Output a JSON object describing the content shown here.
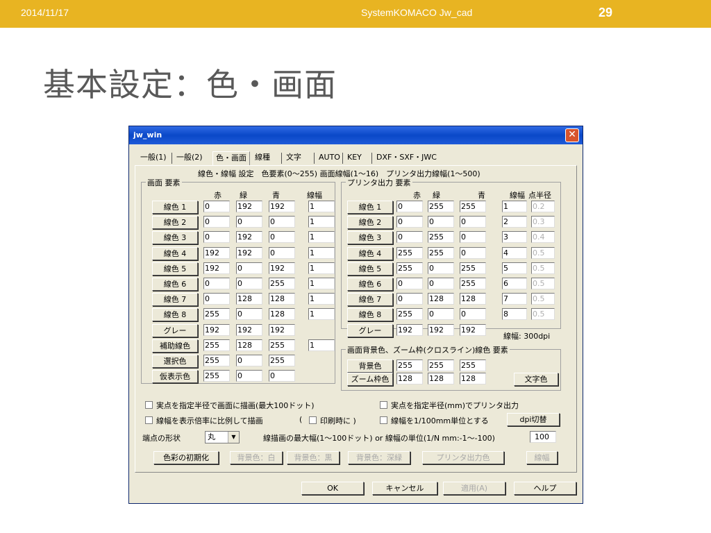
{
  "slide": {
    "date": "2014/11/17",
    "center": "SystemKOMACO Jw_cad",
    "page_number": "29",
    "title": "基本設定：色・画面"
  },
  "window": {
    "title": "jw_win",
    "close_glyph": "✕"
  },
  "tabs": [
    "一般(1)",
    "一般(2)",
    "色・画面",
    "線種",
    "文字",
    "AUTO",
    "KEY",
    "DXF・SXF・JWC"
  ],
  "header_text": "線色・線幅 設定　色要素(0〜255)  画面線幅(1〜16)　プリンタ出力線幅(1〜500)",
  "screen_group": {
    "title": "画面 要素",
    "col_headers": [
      "赤",
      "緑",
      "青",
      "線幅"
    ],
    "rows": [
      {
        "label": "線色 1",
        "r": "0",
        "g": "192",
        "b": "192",
        "w": "1"
      },
      {
        "label": "線色 2",
        "r": "0",
        "g": "0",
        "b": "0",
        "w": "1"
      },
      {
        "label": "線色 3",
        "r": "0",
        "g": "192",
        "b": "0",
        "w": "1"
      },
      {
        "label": "線色 4",
        "r": "192",
        "g": "192",
        "b": "0",
        "w": "1"
      },
      {
        "label": "線色 5",
        "r": "192",
        "g": "0",
        "b": "192",
        "w": "1"
      },
      {
        "label": "線色 6",
        "r": "0",
        "g": "0",
        "b": "255",
        "w": "1"
      },
      {
        "label": "線色 7",
        "r": "0",
        "g": "128",
        "b": "128",
        "w": "1"
      },
      {
        "label": "線色 8",
        "r": "255",
        "g": "0",
        "b": "128",
        "w": "1"
      },
      {
        "label": "グレー",
        "r": "192",
        "g": "192",
        "b": "192",
        "w": ""
      },
      {
        "label": "補助線色",
        "r": "255",
        "g": "128",
        "b": "255",
        "w": "1"
      },
      {
        "label": "選択色",
        "r": "255",
        "g": "0",
        "b": "255",
        "w": ""
      },
      {
        "label": "仮表示色",
        "r": "255",
        "g": "0",
        "b": "0",
        "w": ""
      }
    ]
  },
  "printer_group": {
    "title": "プリンタ出力 要素",
    "col_headers": [
      "赤",
      "緑",
      "青",
      "線幅",
      "点半径"
    ],
    "rows": [
      {
        "label": "線色 1",
        "r": "0",
        "g": "255",
        "b": "255",
        "w": "1",
        "p": "0.2"
      },
      {
        "label": "線色 2",
        "r": "0",
        "g": "0",
        "b": "0",
        "w": "2",
        "p": "0.3"
      },
      {
        "label": "線色 3",
        "r": "0",
        "g": "255",
        "b": "0",
        "w": "3",
        "p": "0.4"
      },
      {
        "label": "線色 4",
        "r": "255",
        "g": "255",
        "b": "0",
        "w": "4",
        "p": "0.5"
      },
      {
        "label": "線色 5",
        "r": "255",
        "g": "0",
        "b": "255",
        "w": "5",
        "p": "0.5"
      },
      {
        "label": "線色 6",
        "r": "0",
        "g": "0",
        "b": "255",
        "w": "6",
        "p": "0.5"
      },
      {
        "label": "線色 7",
        "r": "0",
        "g": "128",
        "b": "128",
        "w": "7",
        "p": "0.5"
      },
      {
        "label": "線色 8",
        "r": "255",
        "g": "0",
        "b": "0",
        "w": "8",
        "p": "0.5"
      },
      {
        "label": "グレー",
        "r": "192",
        "g": "192",
        "b": "192",
        "w": "",
        "p": ""
      }
    ],
    "dpi_text": "線幅: 300dpi"
  },
  "bg_group": {
    "title": "画面背景色、ズーム枠(クロスライン)線色 要素",
    "rows": [
      {
        "label": "背景色",
        "r": "255",
        "g": "255",
        "b": "255"
      },
      {
        "label": "ズーム枠色",
        "r": "128",
        "g": "128",
        "b": "128"
      }
    ],
    "text_color_btn": "文字色"
  },
  "options": {
    "chk1": "実点を指定半径で画面に描画(最大100ドット)",
    "chk2": "実点を指定半径(mm)でプリンタ出力",
    "chk3": "線幅を表示倍率に比例して描画",
    "chk4_pre": "(",
    "chk4": "印刷時に )",
    "chk5": "線幅を1/100mm単位とする",
    "dpi_btn": "dpi切替",
    "endpoint_label": "端点の形状",
    "endpoint_value": "丸",
    "max_width_text": "線描画の最大幅(1〜100ドット) or 線幅の単位(1/N mm:-1〜-100)",
    "max_width_value": "100"
  },
  "bottom_buttons": {
    "init": "色彩の初期化",
    "bg_white": "背景色：白",
    "bg_black": "背景色：黒",
    "bg_dark": "背景色：深緑",
    "printer_color": "プリンタ出力色",
    "width": "線幅"
  },
  "dialog_buttons": {
    "ok": "OK",
    "cancel": "キャンセル",
    "apply": "適用(A)",
    "help": "ヘルプ"
  }
}
